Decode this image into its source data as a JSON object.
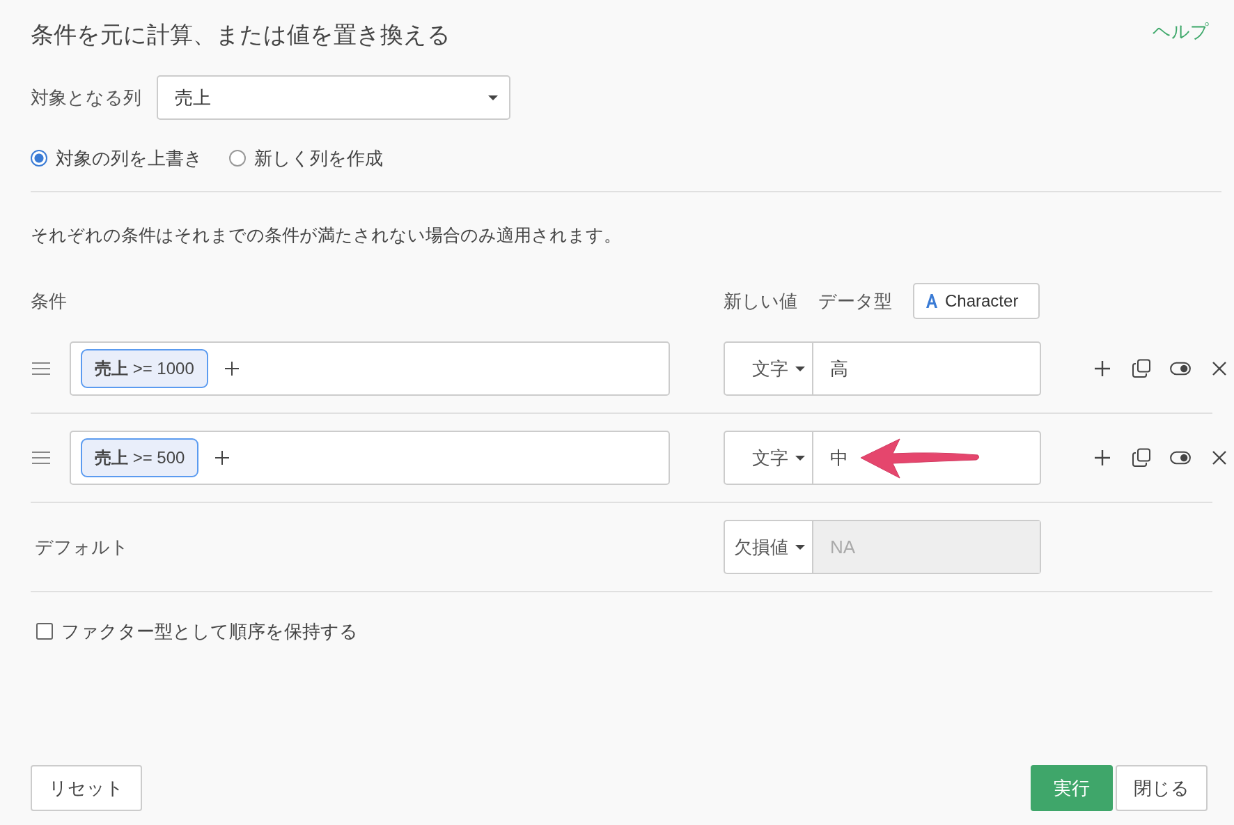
{
  "dialog": {
    "title": "条件を元に計算、または値を置き換える",
    "help_link": "ヘルプ"
  },
  "target_column": {
    "label": "対象となる列",
    "value": "売上"
  },
  "output_options": [
    {
      "label": "対象の列を上書き",
      "selected": true
    },
    {
      "label": "新しく列を作成",
      "selected": false
    }
  ],
  "note": "それぞれの条件はそれまでの条件が満たされない場合のみ適用されます。",
  "conditions_header": {
    "label": "条件",
    "new_value_label": "新しい値",
    "data_type_label": "データ型",
    "data_type": "Character"
  },
  "conditions": [
    {
      "chips": [
        "**売上** >= 1000"
      ],
      "value_type": "文字",
      "value": "高",
      "visible": true,
      "arrow": false
    },
    {
      "chips": [
        "**売上** >= 500"
      ],
      "value_type": "文字",
      "value": "中",
      "visible": true,
      "arrow": true
    }
  ],
  "default": {
    "label": "デフォルト",
    "value_type": "欠損値",
    "placeholder": "NA",
    "disabled": true
  },
  "keep_factor_order": {
    "label": "ファクター型として順序を保持する",
    "checked": false
  },
  "buttons": [
    {
      "label": "リセット",
      "kind": "secondary"
    },
    {
      "label": "実行",
      "kind": "primary"
    },
    {
      "label": "閉じる",
      "kind": "secondary"
    }
  ]
}
